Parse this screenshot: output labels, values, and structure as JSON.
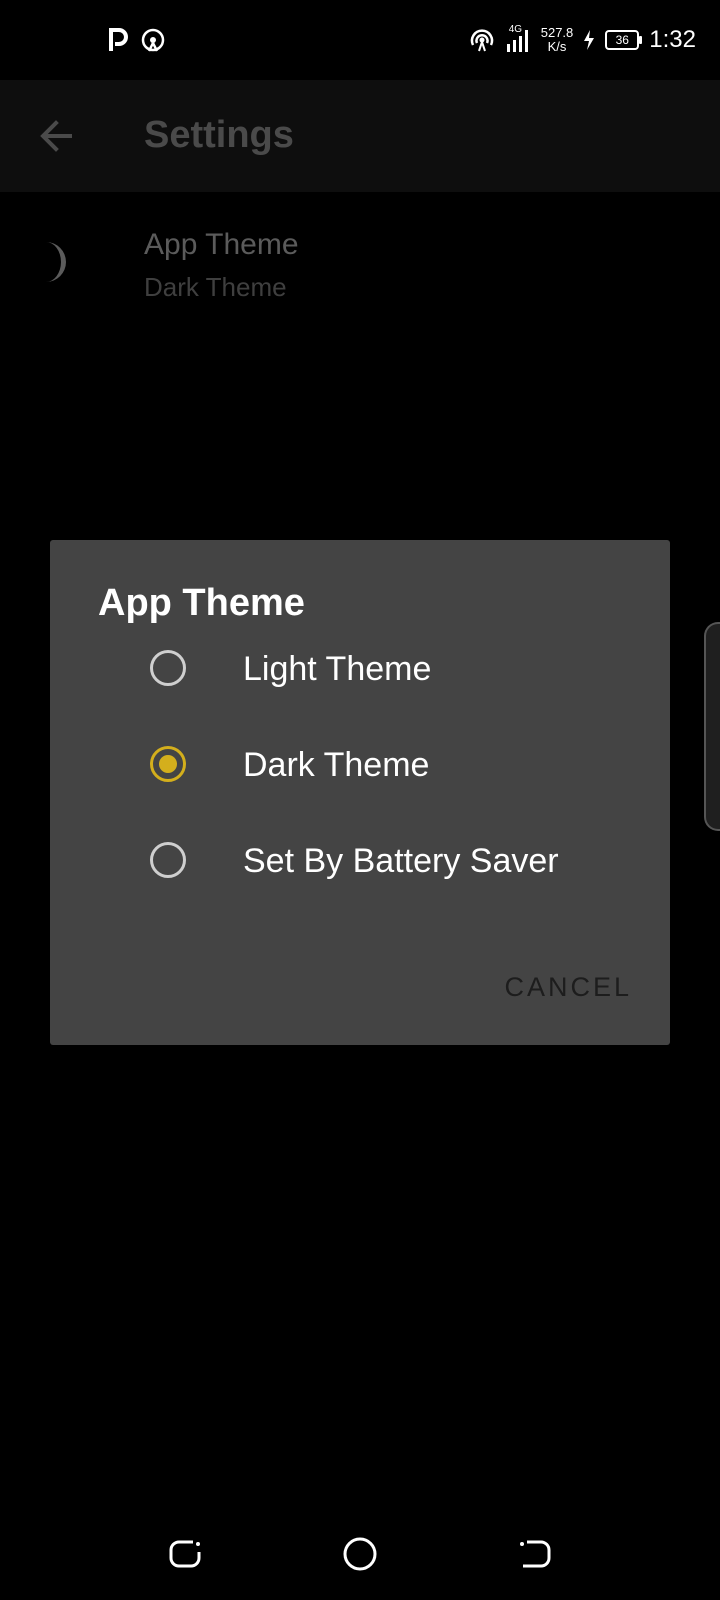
{
  "status_bar": {
    "time": "1:32",
    "network_type": "4G",
    "speed_value": "527.8",
    "speed_unit": "K/s",
    "battery_level": "36",
    "left_icons": [
      "p-notification-icon",
      "hotspot-icon"
    ],
    "right_icons": [
      "hotspot-icon",
      "signal-icon",
      "charging-icon"
    ]
  },
  "app_bar": {
    "title": "Settings",
    "back_icon": "arrow-left-icon"
  },
  "settings": {
    "app_theme": {
      "title": "App Theme",
      "value": "Dark Theme",
      "icon": "moon-icon"
    }
  },
  "dialog": {
    "title": "App Theme",
    "options": [
      {
        "label": "Light Theme",
        "selected": false
      },
      {
        "label": "Dark Theme",
        "selected": true
      },
      {
        "label": "Set By Battery Saver",
        "selected": false
      }
    ],
    "cancel_label": "CANCEL",
    "accent_color": "#d4af1c"
  },
  "nav_bar": {
    "buttons": [
      "recent-apps-icon",
      "home-icon",
      "back-icon"
    ]
  }
}
